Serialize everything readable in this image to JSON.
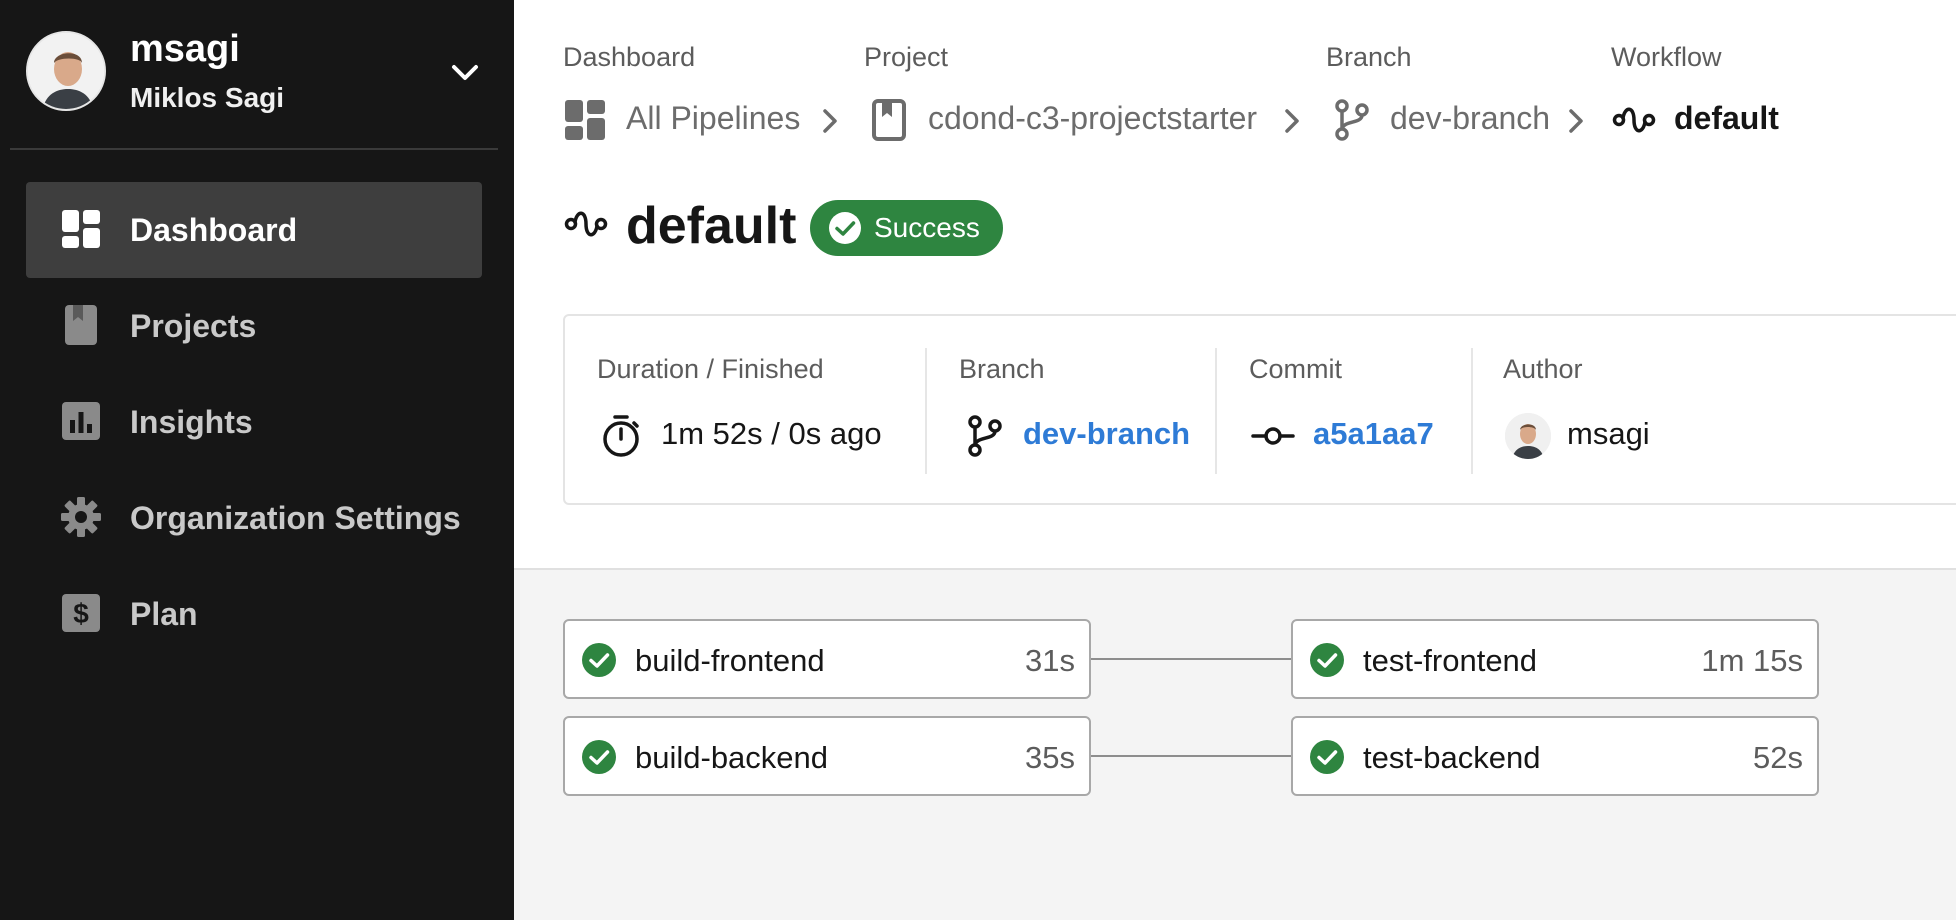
{
  "user": {
    "handle": "msagi",
    "full_name": "Miklos Sagi",
    "menu_icon": "chevron-down-icon"
  },
  "sidebar": {
    "items": [
      {
        "label": "Dashboard",
        "icon": "dashboard-icon",
        "active": true
      },
      {
        "label": "Projects",
        "icon": "project-icon",
        "active": false
      },
      {
        "label": "Insights",
        "icon": "insights-icon",
        "active": false
      },
      {
        "label": "Organization Settings",
        "icon": "gear-icon",
        "active": false
      },
      {
        "label": "Plan",
        "icon": "dollar-icon",
        "active": false
      }
    ]
  },
  "breadcrumb": [
    {
      "heading": "Dashboard",
      "label": "All Pipelines",
      "icon": "dashboard-icon"
    },
    {
      "heading": "Project",
      "label": "cdond-c3-projectstarter",
      "icon": "project-icon"
    },
    {
      "heading": "Branch",
      "label": "dev-branch",
      "icon": "branch-icon"
    },
    {
      "heading": "Workflow",
      "label": "default",
      "icon": "workflow-icon"
    }
  ],
  "workflow": {
    "title": "default",
    "status": "Success"
  },
  "info": {
    "duration": {
      "label": "Duration / Finished",
      "value": "1m 52s / 0s ago"
    },
    "branch": {
      "label": "Branch",
      "value": "dev-branch"
    },
    "commit": {
      "label": "Commit",
      "value": "a5a1aa7"
    },
    "author": {
      "label": "Author",
      "value": "msagi"
    }
  },
  "jobs": [
    {
      "name": "build-frontend",
      "duration": "31s",
      "status": "success"
    },
    {
      "name": "test-frontend",
      "duration": "1m 15s",
      "status": "success"
    },
    {
      "name": "build-backend",
      "duration": "35s",
      "status": "success"
    },
    {
      "name": "test-backend",
      "duration": "52s",
      "status": "success"
    }
  ],
  "colors": {
    "sidebar_bg": "#161616",
    "success": "#2e8540",
    "link": "#2e7bd6"
  }
}
